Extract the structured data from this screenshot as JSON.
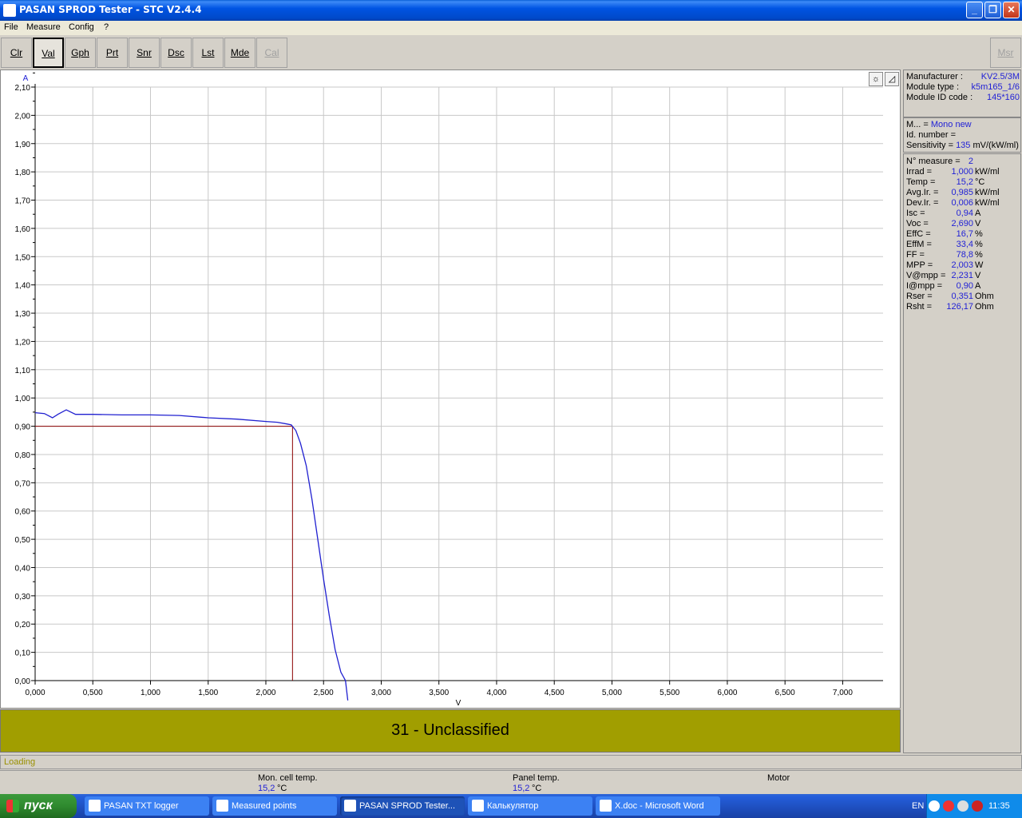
{
  "window": {
    "title": "PASAN SPROD Tester - STC V2.4.4"
  },
  "menu": [
    "File",
    "Measure",
    "Config",
    "?"
  ],
  "toolbar": [
    {
      "label": "Clr",
      "state": "normal"
    },
    {
      "label": "Val",
      "state": "pressed"
    },
    {
      "label": "Gph",
      "state": "normal"
    },
    {
      "label": "Prt",
      "state": "normal"
    },
    {
      "label": "Snr",
      "state": "normal"
    },
    {
      "label": "Dsc",
      "state": "normal"
    },
    {
      "label": "Lst",
      "state": "normal"
    },
    {
      "label": "Mde",
      "state": "normal"
    },
    {
      "label": "Cal",
      "state": "disabled"
    }
  ],
  "msr_button": "Msr",
  "chart_data": {
    "type": "line",
    "xlabel": "V",
    "ylabel": "A",
    "xlim": [
      0,
      7.35
    ],
    "ylim": [
      0,
      2.1
    ],
    "x_ticks": [
      "0,000",
      "0,500",
      "1,000",
      "1,500",
      "2,000",
      "2,500",
      "3,000",
      "3,500",
      "4,000",
      "4,500",
      "5,000",
      "5,500",
      "6,000",
      "6,500",
      "7,000"
    ],
    "y_ticks": [
      "0,00",
      "0,10",
      "0,20",
      "0,30",
      "0,40",
      "0,50",
      "0,60",
      "0,70",
      "0,80",
      "0,90",
      "1,00",
      "1,10",
      "1,20",
      "1,30",
      "1,40",
      "1,50",
      "1,60",
      "1,70",
      "1,80",
      "1,90",
      "2,00",
      "2,10"
    ],
    "grid": true,
    "series": [
      {
        "color": "#2020d0",
        "x": [
          0.0,
          0.08,
          0.15,
          0.2,
          0.27,
          0.35,
          0.5,
          0.75,
          1.0,
          1.25,
          1.5,
          1.75,
          2.0,
          2.1,
          2.18,
          2.22,
          2.26,
          2.3,
          2.35,
          2.4,
          2.45,
          2.5,
          2.55,
          2.6,
          2.65,
          2.69,
          2.71
        ],
        "y": [
          0.948,
          0.945,
          0.93,
          0.943,
          0.958,
          0.942,
          0.942,
          0.94,
          0.94,
          0.938,
          0.93,
          0.925,
          0.917,
          0.914,
          0.908,
          0.905,
          0.885,
          0.84,
          0.76,
          0.64,
          0.5,
          0.36,
          0.23,
          0.11,
          0.03,
          0.0,
          -0.07
        ]
      }
    ],
    "mpp_marker": {
      "v": 2.231,
      "i": 0.9,
      "color": "#8b0000"
    }
  },
  "classification": "31 - Unclassified",
  "module_info": {
    "manufacturer_label": "Manufacturer :",
    "manufacturer": "KV2.5/3M",
    "module_type_label": "Module type :",
    "module_type": "k5m165_1/6",
    "module_id_label": "Module ID code :",
    "module_id": "145*160"
  },
  "reference": {
    "m_label": "M... =",
    "m_value": "Mono new",
    "id_label": "Id. number =",
    "id_value": "",
    "sens_label": "Sensitivity =",
    "sens_value": "135",
    "sens_unit": "mV/(kW/ml)"
  },
  "measurements": [
    {
      "label": "N° measure =",
      "value": "2",
      "unit": ""
    },
    {
      "label": "Irrad =",
      "value": "1,000",
      "unit": "kW/ml"
    },
    {
      "label": "Temp =",
      "value": "15,2",
      "unit": "°C"
    },
    {
      "label": "Avg.Ir. =",
      "value": "0,985",
      "unit": "kW/ml"
    },
    {
      "label": "Dev.Ir. =",
      "value": "0,006",
      "unit": "kW/ml"
    },
    {
      "label": "Isc =",
      "value": "0,94",
      "unit": "A"
    },
    {
      "label": "Voc =",
      "value": "2,690",
      "unit": "V"
    },
    {
      "label": "EffC =",
      "value": "16,7",
      "unit": "%"
    },
    {
      "label": "EffM =",
      "value": "33,4",
      "unit": "%"
    },
    {
      "label": "FF =",
      "value": "78,8",
      "unit": "%"
    },
    {
      "label": "MPP =",
      "value": "2,003",
      "unit": "W"
    },
    {
      "label": "V@mpp =",
      "value": "2,231",
      "unit": "V"
    },
    {
      "label": "I@mpp =",
      "value": "0,90",
      "unit": "A"
    },
    {
      "label": "Rser =",
      "value": "0,351",
      "unit": "Ohm"
    },
    {
      "label": "Rsht =",
      "value": "126,17",
      "unit": "Ohm"
    }
  ],
  "status": {
    "loading": "Loading",
    "mon_cell_label": "Mon. cell temp.",
    "mon_cell_value": "15,2",
    "mon_cell_unit": "°C",
    "panel_label": "Panel temp.",
    "panel_value": "15,2",
    "panel_unit": "°C",
    "motor_label": "Motor"
  },
  "taskbar": {
    "start": "пуск",
    "tasks": [
      {
        "label": "PASAN TXT logger",
        "active": false
      },
      {
        "label": "Measured points",
        "active": false
      },
      {
        "label": "PASAN SPROD Tester...",
        "active": true
      },
      {
        "label": "Калькулятор",
        "active": false
      },
      {
        "label": "X.doc - Microsoft Word",
        "active": false
      }
    ],
    "lang": "EN",
    "clock": "11:35"
  }
}
